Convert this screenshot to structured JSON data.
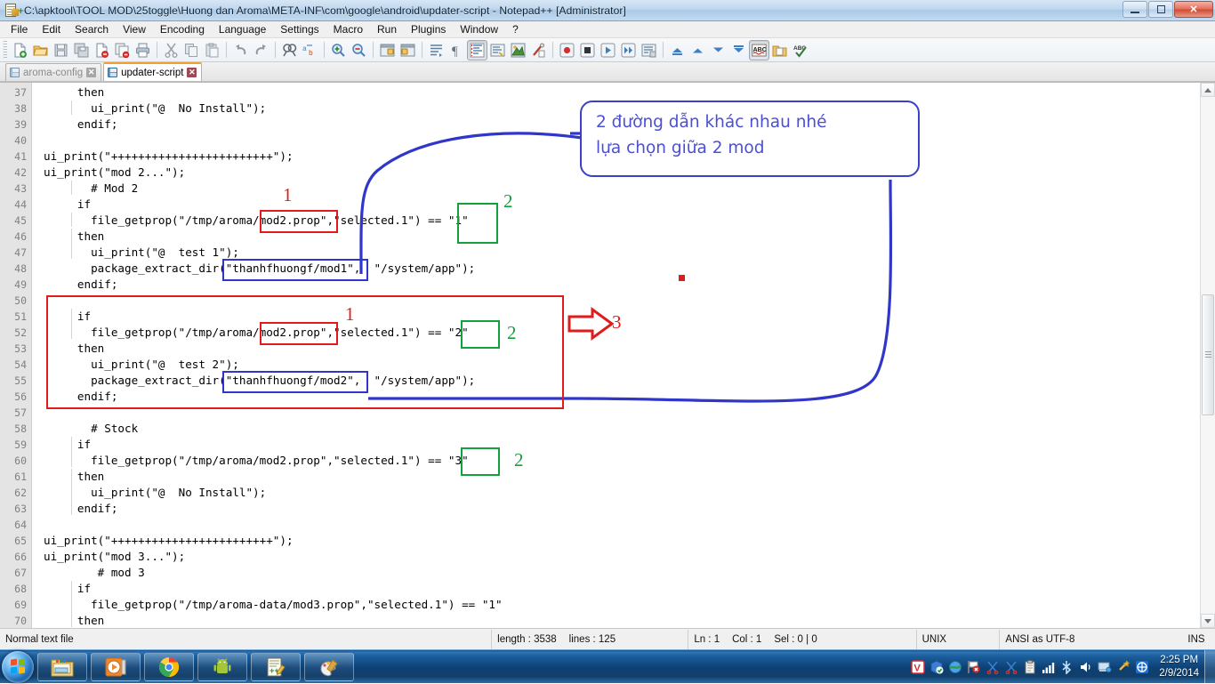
{
  "window": {
    "title": "C:\\apktool\\TOOL MOD\\25toggle\\Huong dan Aroma\\META-INF\\com\\google\\android\\updater-script - Notepad++ [Administrator]",
    "minimize_label": "–",
    "restore_label": "❐",
    "close_label": "✕"
  },
  "menu": {
    "items": [
      {
        "label": "File"
      },
      {
        "label": "Edit"
      },
      {
        "label": "Search"
      },
      {
        "label": "View"
      },
      {
        "label": "Encoding"
      },
      {
        "label": "Language"
      },
      {
        "label": "Settings"
      },
      {
        "label": "Macro"
      },
      {
        "label": "Run"
      },
      {
        "label": "Plugins"
      },
      {
        "label": "Window"
      },
      {
        "label": "?"
      }
    ]
  },
  "toolbar": {
    "buttons": [
      "new-file-icon",
      "open-file-icon",
      "save-icon",
      "save-all-icon",
      "close-file-icon",
      "close-all-icon",
      "print-icon",
      "cut-icon",
      "copy-icon",
      "paste-icon",
      "undo-icon",
      "redo-icon",
      "find-icon",
      "replace-icon",
      "zoom-in-icon",
      "zoom-out-icon",
      "sync-vertical-scroll-icon",
      "sync-horizontal-scroll-icon",
      "word-wrap-icon",
      "show-all-characters-icon",
      "pilcrow-icon",
      "indent-guide-icon",
      "user-defined-dialog-icon",
      "document-map-icon",
      "function-list-icon",
      "start-record-macro-icon",
      "stop-record-macro-icon",
      "play-macro-icon",
      "run-macro-multiple-icon",
      "save-macro-icon",
      "first-bookmark-icon",
      "previous-bookmark-icon",
      "next-bookmark-icon",
      "last-bookmark-icon",
      "spell-check-abc-icon",
      "document-folder-icon",
      "spell-check-tick-icon"
    ]
  },
  "tabs": [
    {
      "label": "aroma-config",
      "active": false,
      "close_label": "✕"
    },
    {
      "label": "updater-script",
      "active": true,
      "close_label": "✕"
    }
  ],
  "editor": {
    "first_line": 37,
    "lines": [
      {
        "n": 37,
        "text": "     then"
      },
      {
        "n": 38,
        "text": "       ui_print(\"@  No Install\");"
      },
      {
        "n": 39,
        "text": "     endif;"
      },
      {
        "n": 40,
        "text": ""
      },
      {
        "n": 41,
        "text": "ui_print(\"++++++++++++++++++++++++\");"
      },
      {
        "n": 42,
        "text": "ui_print(\"mod 2...\");"
      },
      {
        "n": 43,
        "text": "       # Mod 2"
      },
      {
        "n": 44,
        "text": "     if"
      },
      {
        "n": 45,
        "text": "       file_getprop(\"/tmp/aroma/mod2.prop\",\"selected.1\") == \"1\""
      },
      {
        "n": 46,
        "text": "     then"
      },
      {
        "n": 47,
        "text": "       ui_print(\"@  test 1\");"
      },
      {
        "n": 48,
        "text": "       package_extract_dir(\"thanhfhuongf/mod1\",  \"/system/app\");"
      },
      {
        "n": 49,
        "text": "     endif;"
      },
      {
        "n": 50,
        "text": ""
      },
      {
        "n": 51,
        "text": "     if"
      },
      {
        "n": 52,
        "text": "       file_getprop(\"/tmp/aroma/mod2.prop\",\"selected.1\") == \"2\""
      },
      {
        "n": 53,
        "text": "     then"
      },
      {
        "n": 54,
        "text": "       ui_print(\"@  test 2\");"
      },
      {
        "n": 55,
        "text": "       package_extract_dir(\"thanhfhuongf/mod2\",  \"/system/app\");"
      },
      {
        "n": 56,
        "text": "     endif;"
      },
      {
        "n": 57,
        "text": ""
      },
      {
        "n": 58,
        "text": "       # Stock"
      },
      {
        "n": 59,
        "text": "     if"
      },
      {
        "n": 60,
        "text": "       file_getprop(\"/tmp/aroma/mod2.prop\",\"selected.1\") == \"3\""
      },
      {
        "n": 61,
        "text": "     then"
      },
      {
        "n": 62,
        "text": "       ui_print(\"@  No Install\");"
      },
      {
        "n": 63,
        "text": "     endif;"
      },
      {
        "n": 64,
        "text": ""
      },
      {
        "n": 65,
        "text": "ui_print(\"++++++++++++++++++++++++\");"
      },
      {
        "n": 66,
        "text": "ui_print(\"mod 3...\");"
      },
      {
        "n": 67,
        "text": "        # mod 3"
      },
      {
        "n": 68,
        "text": "     if"
      },
      {
        "n": 69,
        "text": "       file_getprop(\"/tmp/aroma-data/mod3.prop\",\"selected.1\") == \"1\""
      },
      {
        "n": 70,
        "text": "     then"
      }
    ]
  },
  "annotations": {
    "callout": {
      "line1": "2 đường dẫn khác nhau nhé",
      "line2": "lựa chọn giữa 2 mod",
      "color": "#4a4fd6"
    },
    "markers": [
      {
        "label": "1",
        "color": "#e01b1b",
        "for": "mod2.prop path line 45"
      },
      {
        "label": "2",
        "color": "#14a03c",
        "for": "selected value \"1\" line 45"
      },
      {
        "label": "1",
        "color": "#e01b1b",
        "for": "mod2.prop path line 52"
      },
      {
        "label": "2",
        "color": "#14a03c",
        "for": "selected value \"2\" line 52"
      },
      {
        "label": "3",
        "color": "#e01b1b",
        "for": "whole if-block lines 50-56"
      },
      {
        "label": "2",
        "color": "#14a03c",
        "for": "selected value \"3\" line 60"
      }
    ],
    "colors": {
      "red": "#e01b1b",
      "green": "#14a03c",
      "blue": "#2f36c9"
    }
  },
  "statusbar": {
    "file_type": "Normal text file",
    "length_label": "length : 3538",
    "lines_label": "lines : 125",
    "ln": "Ln : 1",
    "col": "Col : 1",
    "sel": "Sel : 0 | 0",
    "eol": "UNIX",
    "encoding": "ANSI as UTF-8",
    "insert_mode": "INS"
  },
  "taskbar": {
    "start_label": "Start",
    "items": [
      {
        "name": "windows-explorer-icon"
      },
      {
        "name": "media-player-icon"
      },
      {
        "name": "google-chrome-icon"
      },
      {
        "name": "android-sdk-icon"
      },
      {
        "name": "notepad-plus-plus-icon"
      },
      {
        "name": "paint-icon"
      }
    ],
    "tray": [
      "antivirus-v-icon",
      "package-check-icon",
      "updater-globe-icon",
      "flag-error-icon",
      "scissors-red-icon",
      "scissors-red-2-icon",
      "clipboard-icon",
      "signal-bars-icon",
      "bluetooth-icon",
      "volume-icon",
      "network-icon",
      "wizard-star-icon",
      "teamviewer-icon"
    ],
    "clock_time": "2:25 PM",
    "clock_date": "2/9/2014"
  }
}
